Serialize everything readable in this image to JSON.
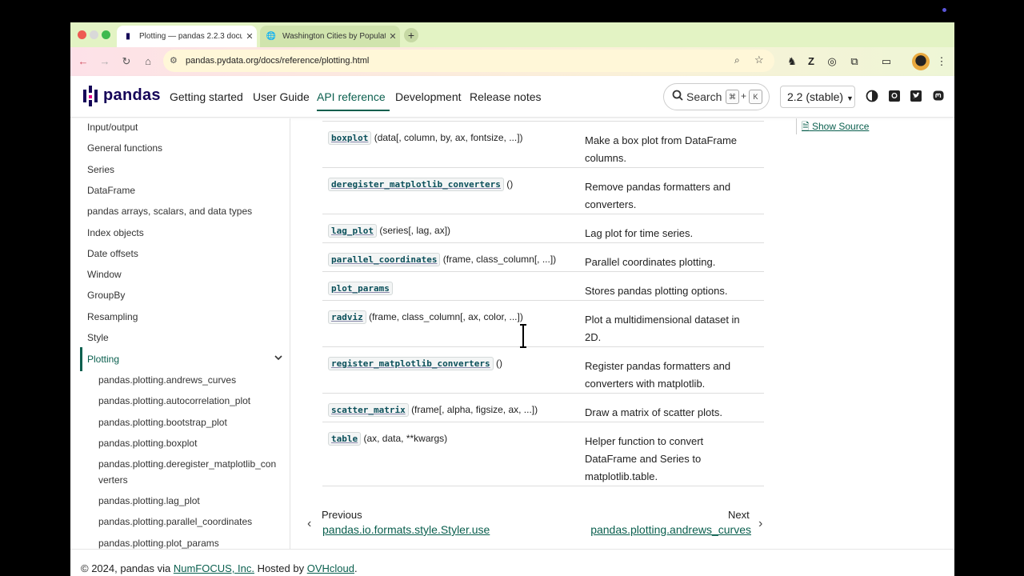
{
  "browser": {
    "tabs": [
      {
        "title": "Plotting — pandas 2.2.3 docu",
        "active": true
      },
      {
        "title": "Washington Cities by Populati",
        "active": false
      }
    ],
    "new_tab": "+",
    "url": "pandas.pydata.org/docs/reference/plotting.html"
  },
  "header": {
    "logo_text": "pandas",
    "nav": [
      "Getting started",
      "User Guide",
      "API reference",
      "Development",
      "Release notes"
    ],
    "active_nav": "API reference",
    "search_label": "Search",
    "search_keys": [
      "⌘",
      "K"
    ],
    "search_plus": "+",
    "version": "2.2 (stable)"
  },
  "sidebar": {
    "items": [
      "Input/output",
      "General functions",
      "Series",
      "DataFrame",
      "pandas arrays, scalars, and data types",
      "Index objects",
      "Date offsets",
      "Window",
      "GroupBy",
      "Resampling",
      "Style",
      "Plotting"
    ],
    "active": "Plotting",
    "subitems": [
      [
        "pandas.plotting.andrews_curves"
      ],
      [
        "pandas.plotting.autocorrelation_plot"
      ],
      [
        "pandas.plotting.bootstrap_plot"
      ],
      [
        "pandas.plotting.boxplot"
      ],
      [
        "pandas.plotting.deregister_matplotlib_con",
        "verters"
      ],
      [
        "pandas.plotting.lag_plot"
      ],
      [
        "pandas.plotting.parallel_coordinates"
      ],
      [
        "pandas.plotting.plot_params"
      ]
    ]
  },
  "api_rows": [
    {
      "name": "boxplot",
      "args": "(data[, column, by, ax, fontsize, ...])",
      "desc": [
        "Make a box plot from DataFrame",
        "columns."
      ]
    },
    {
      "name": "deregister_matplotlib_converters",
      "args": "()",
      "desc": [
        "Remove pandas formatters and",
        "converters."
      ]
    },
    {
      "name": "lag_plot",
      "args": "(series[, lag, ax])",
      "desc": [
        "Lag plot for time series."
      ]
    },
    {
      "name": "parallel_coordinates",
      "args": "(frame, class_column[, ...])",
      "desc": [
        "Parallel coordinates plotting."
      ]
    },
    {
      "name": "plot_params",
      "args": "",
      "desc": [
        "Stores pandas plotting options."
      ]
    },
    {
      "name": "radviz",
      "args": "(frame, class_column[, ax, color, ...])",
      "desc": [
        "Plot a multidimensional dataset in",
        "2D."
      ]
    },
    {
      "name": "register_matplotlib_converters",
      "args": "()",
      "desc": [
        "Register pandas formatters and",
        "converters with matplotlib."
      ]
    },
    {
      "name": "scatter_matrix",
      "args": "(frame[, alpha, figsize, ax, ...])",
      "desc": [
        "Draw a matrix of scatter plots."
      ]
    },
    {
      "name": "table",
      "args": "(ax, data, **kwargs)",
      "desc": [
        "Helper function to convert",
        "DataFrame and Series to",
        "matplotlib.table."
      ]
    }
  ],
  "pager": {
    "prev_label": "Previous",
    "prev_link": "pandas.io.formats.style.Styler.use",
    "next_label": "Next",
    "next_link": "pandas.plotting.andrews_curves"
  },
  "secondary": {
    "show_source": "Show Source"
  },
  "footer": {
    "prefix": "© 2024, pandas via ",
    "numfocus": "NumFOCUS, Inc.",
    "hosted": " Hosted by ",
    "ovh": "OVHcloud",
    "suffix": "."
  },
  "colors": {
    "accent": "#0a5f4e",
    "brand": "#150458"
  }
}
